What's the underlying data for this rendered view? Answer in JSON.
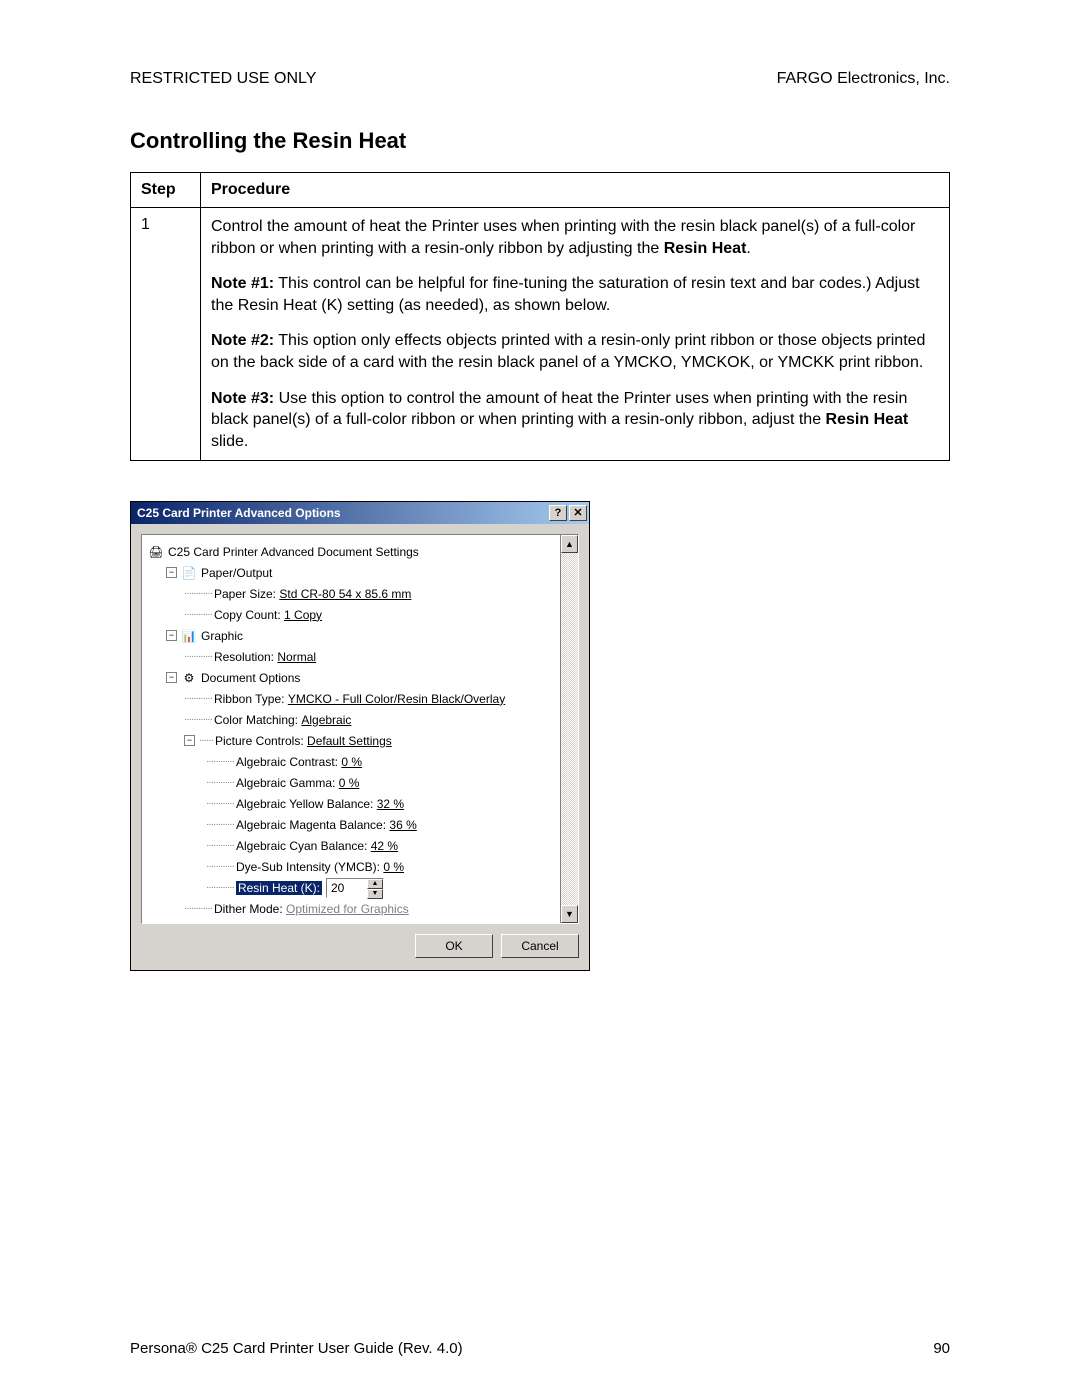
{
  "header": {
    "left": "RESTRICTED USE ONLY",
    "right": "FARGO Electronics, Inc."
  },
  "title": "Controlling the Resin Heat",
  "table": {
    "columns": [
      "Step",
      "Procedure"
    ],
    "rows": [
      {
        "step": "1",
        "paragraphs": [
          {
            "pre": "Control the amount of heat the Printer uses when printing with the resin black panel(s) of a full-color ribbon or when printing with a resin-only ribbon by adjusting the ",
            "bold": "Resin Heat",
            "post": "."
          },
          {
            "lead": "Note #1:",
            "body": "  This control can be helpful for fine-tuning the saturation of resin text and bar codes.)  Adjust the Resin Heat (K) setting (as needed), as shown below."
          },
          {
            "lead": "Note #2:",
            "body": "  This option only effects objects printed with a resin-only print ribbon or those objects printed on the back side of a card with the resin black panel of a YMCKO, YMCKOK, or YMCKK print ribbon."
          },
          {
            "lead": "Note #3:",
            "body_pre": "  Use this option to control the amount of heat the Printer uses when printing with the resin black panel(s) of a full-color ribbon or when printing with a resin-only ribbon, adjust the ",
            "body_bold": "Resin Heat",
            "body_post": " slide."
          }
        ]
      }
    ]
  },
  "dialog": {
    "title": "C25 Card Printer Advanced Options",
    "tree": {
      "root": "C25 Card Printer Advanced Document Settings",
      "paper_output": {
        "label": "Paper/Output",
        "paper_size": {
          "label": "Paper Size:",
          "value": "Std CR-80  54 x 85.6 mm"
        },
        "copy_count": {
          "label": "Copy Count:",
          "value": "1 Copy"
        }
      },
      "graphic": {
        "label": "Graphic",
        "resolution": {
          "label": "Resolution:",
          "value": "Normal"
        }
      },
      "doc_options": {
        "label": "Document Options",
        "ribbon_type": {
          "label": "Ribbon Type:",
          "value": "YMCKO - Full Color/Resin Black/Overlay"
        },
        "color_matching": {
          "label": "Color Matching:",
          "value": "Algebraic"
        },
        "picture_controls": {
          "label": "Picture Controls:",
          "value": "Default Settings",
          "items": {
            "contrast": {
              "label": "Algebraic Contrast:",
              "value": "0 %"
            },
            "gamma": {
              "label": "Algebraic Gamma:",
              "value": "0 %"
            },
            "yellow": {
              "label": "Algebraic Yellow Balance:",
              "value": "32 %"
            },
            "magenta": {
              "label": "Algebraic Magenta Balance:",
              "value": "36 %"
            },
            "cyan": {
              "label": "Algebraic Cyan Balance:",
              "value": "42 %"
            },
            "dyesub": {
              "label": "Dye-Sub Intensity (YMCB):",
              "value": "0 %"
            },
            "resinheat": {
              "label": "Resin Heat (K):",
              "value": "20"
            }
          }
        },
        "dither": {
          "label": "Dither Mode:",
          "value": "Optimized for Graphics"
        }
      }
    },
    "buttons": {
      "ok": "OK",
      "cancel": "Cancel"
    }
  },
  "footer": {
    "left": "Persona® C25 Card Printer User Guide (Rev. 4.0)",
    "right": "90"
  }
}
